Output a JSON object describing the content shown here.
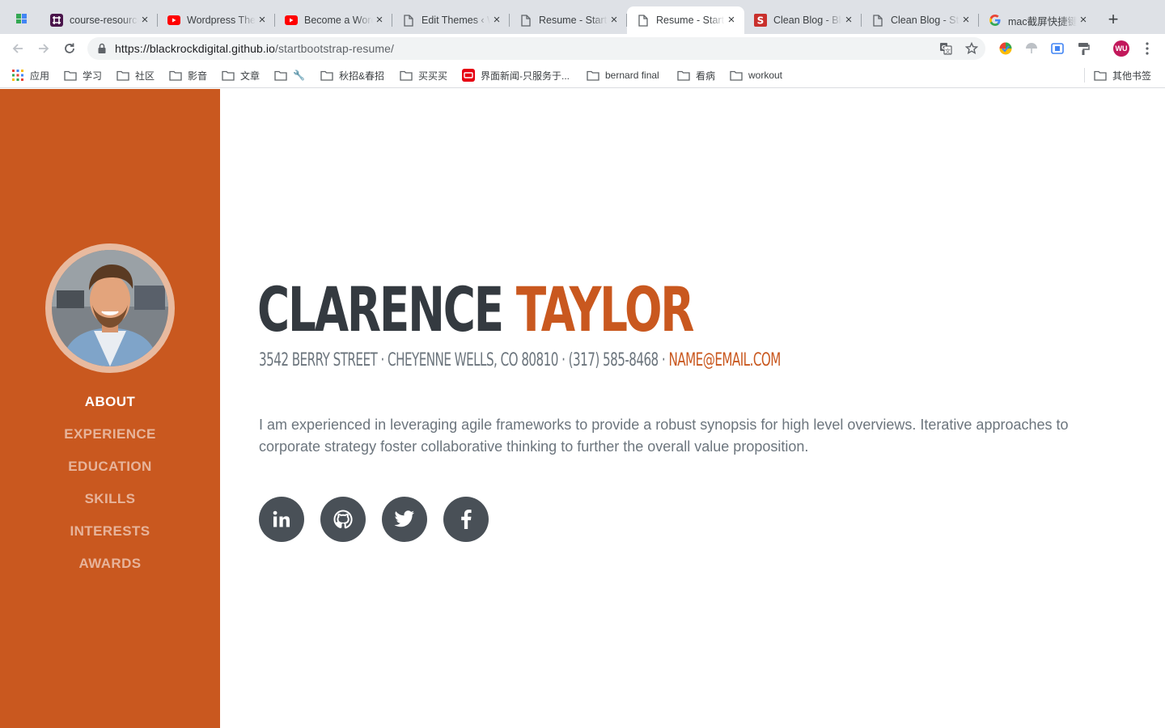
{
  "browser": {
    "tabs": [
      {
        "title": "course-resources",
        "icon": "slack-icon"
      },
      {
        "title": "Wordpress Theme",
        "icon": "youtube-icon"
      },
      {
        "title": "Become a WordPress",
        "icon": "youtube-icon"
      },
      {
        "title": "Edit Themes ‹ WordPress",
        "icon": "document-icon"
      },
      {
        "title": "Resume - Start Bootstrap",
        "icon": "document-icon"
      },
      {
        "title": "Resume - Start Bootstrap",
        "icon": "document-icon",
        "active": true
      },
      {
        "title": "Clean Blog - Blog",
        "icon": "s-logo-icon"
      },
      {
        "title": "Clean Blog - Start Bootstrap",
        "icon": "document-icon"
      },
      {
        "title": "mac截屏快捷键",
        "icon": "google-icon"
      }
    ],
    "url_host": "https://blackrockdigital.github.io",
    "url_path": "/startbootstrap-resume/",
    "profile_initials": "WU",
    "bookmarks": [
      {
        "label": "应用",
        "icon": "apps-grid-icon"
      },
      {
        "label": "学习",
        "icon": "folder-icon"
      },
      {
        "label": "社区",
        "icon": "folder-icon"
      },
      {
        "label": "影音",
        "icon": "folder-icon"
      },
      {
        "label": "文章",
        "icon": "folder-icon"
      },
      {
        "label": "🔧",
        "icon": "folder-icon"
      },
      {
        "label": "秋招&春招",
        "icon": "folder-icon"
      },
      {
        "label": "买买买",
        "icon": "folder-icon"
      },
      {
        "label": "界面新闻-只服务于...",
        "icon": "jiemian-icon"
      },
      {
        "label": "bernard final",
        "icon": "folder-icon"
      },
      {
        "label": "看病",
        "icon": "folder-icon"
      },
      {
        "label": "workout",
        "icon": "folder-icon"
      }
    ],
    "other_bookmarks": "其他书签"
  },
  "page": {
    "nav": [
      "About",
      "Experience",
      "Education",
      "Skills",
      "Interests",
      "Awards"
    ],
    "first_name": "Clarence",
    "last_name": "Taylor",
    "address": "3542 Berry Street · Cheyenne Wells, CO 80810 · (317) 585-8468 ·",
    "email": "name@email.com",
    "lead": "I am experienced in leveraging agile frameworks to provide a robust synopsis for high level overviews. Iterative approaches to corporate strategy foster collaborative thinking to further the overall value proposition.",
    "social": [
      "linkedin-icon",
      "github-icon",
      "twitter-icon",
      "facebook-icon"
    ]
  },
  "colors": {
    "primary": "#c9581f",
    "heading": "#343a40",
    "muted": "#6c757d",
    "social_bg": "#495057"
  }
}
